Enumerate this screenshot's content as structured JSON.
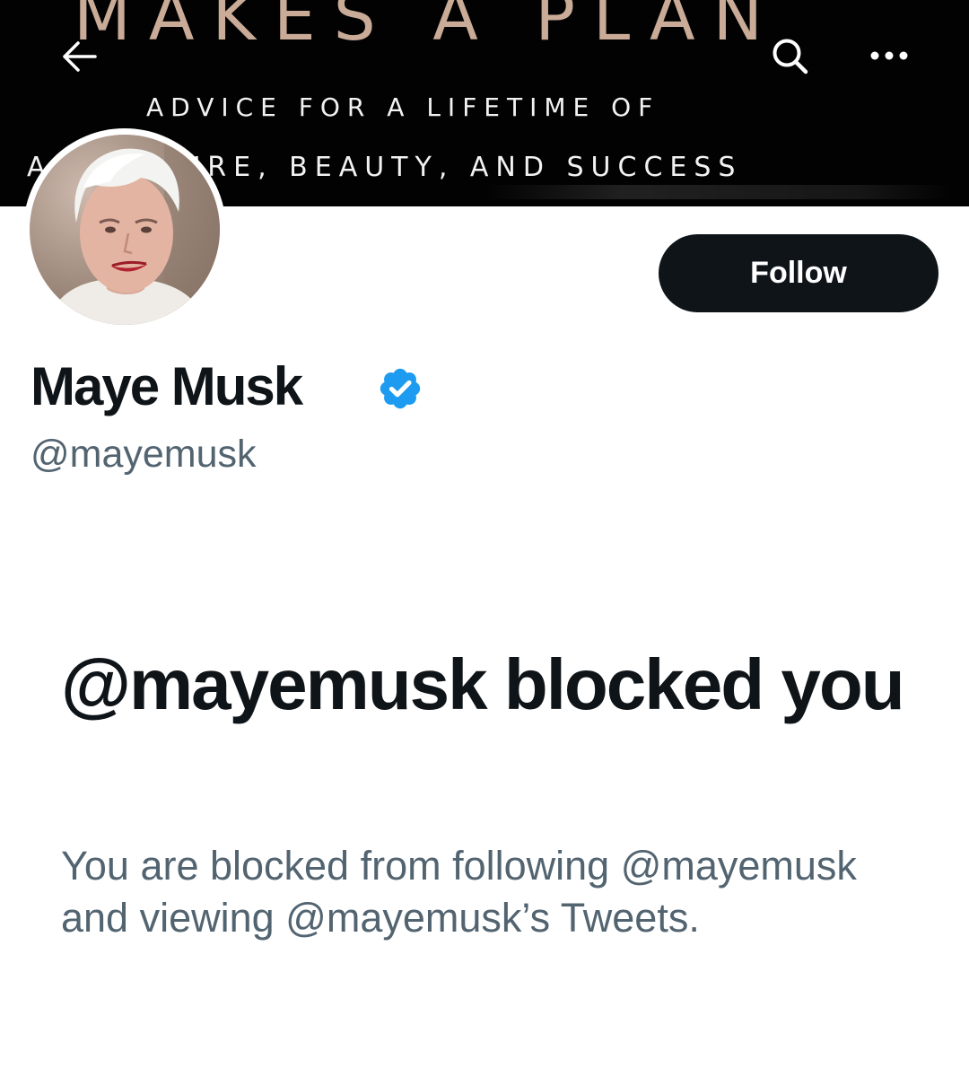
{
  "banner": {
    "title": "MAKES A PLAN",
    "line1": "ADVICE FOR A LIFETIME OF",
    "line2": "ADVENTURE, BEAUTY, AND SUCCESS"
  },
  "nav": {
    "back_icon": "arrow-left-icon",
    "search_icon": "search-icon",
    "more_icon": "more-horizontal-icon"
  },
  "profile": {
    "avatar_icon": "avatar",
    "follow_label": "Follow",
    "display_name": "Maye Musk",
    "verified_icon": "verified-badge-icon",
    "handle": "@mayemusk"
  },
  "blocked": {
    "title": "@mayemusk blocked you",
    "message": "You are blocked from following @mayemusk and viewing @mayemusk’s Tweets."
  },
  "colors": {
    "banner_background": "#020202",
    "banner_title": "#c9ab98",
    "follow_button": "#0f1419",
    "verified_blue": "#1d9bf0",
    "secondary_text": "#536471"
  }
}
